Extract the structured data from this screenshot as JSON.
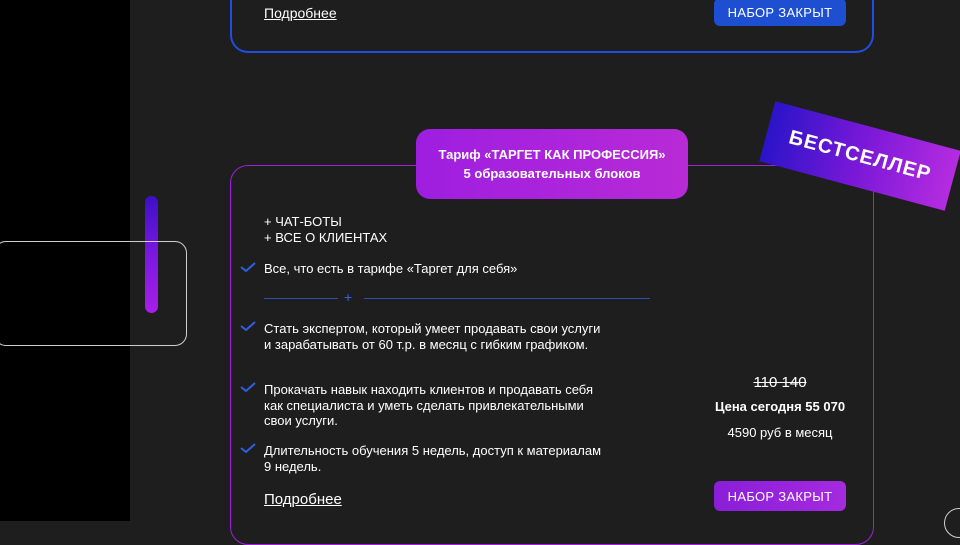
{
  "previous_card": {
    "more_link": "Подробнее",
    "button_label": "НАБОР ЗАКРЫТ"
  },
  "tariff": {
    "title_line1": "Тариф «ТАРГЕТ КАК ПРОФЕССИЯ»",
    "title_line2": "5 образовательных блоков",
    "ribbon": "БЕСТСЕЛЛЕР",
    "extras": [
      "+ ЧАТ-БОТЫ",
      "+ ВСЕ О КЛИЕНТАХ"
    ],
    "base_feature": "Все, что есть в тарифе «Таргет для себя»",
    "divider_symbol": "+",
    "features": [
      "Стать экспертом, который умеет продавать свои услуги и зарабатывать от 60 т.р. в месяц с гибким графиком.",
      "Прокачать навык находить клиентов и продавать себя как специалиста и уметь сделать привлекательными свои услуги.",
      "Длительность обучения 5 недель, доступ к материалам 9 недель."
    ],
    "old_price": "110 140",
    "price_today": "Цена сегодня 55 070",
    "monthly": "4590 руб в месяц",
    "more_link": "Подробнее",
    "button_label": "НАБОР ЗАКРЫТ"
  },
  "colors": {
    "background": "#1e1e1e",
    "left_panel": "#000000",
    "blue_accent": "#1e4fd0",
    "purple_accent": "#a020d8"
  }
}
